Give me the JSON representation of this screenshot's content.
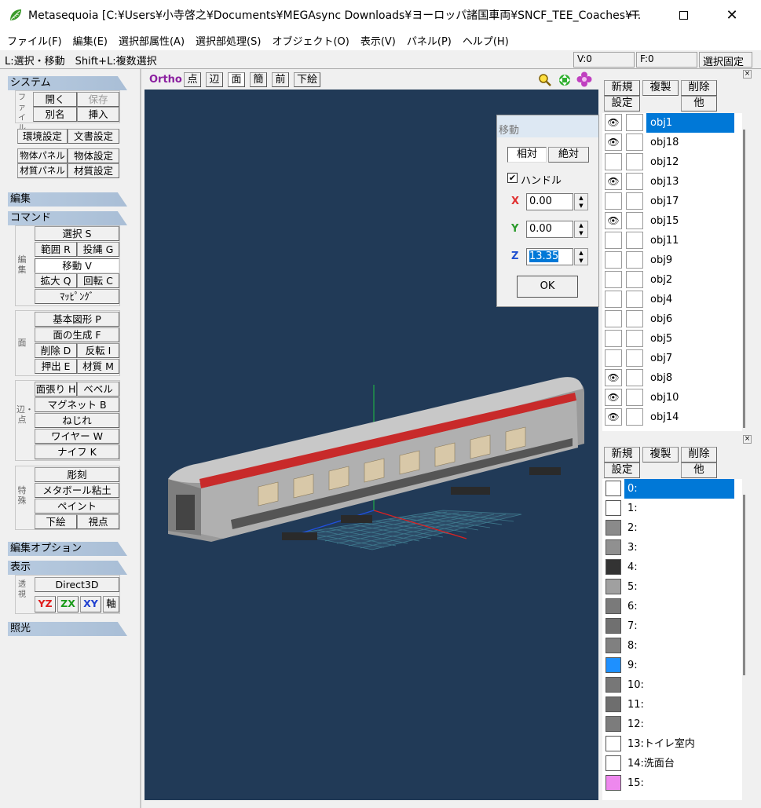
{
  "window": {
    "title": "Metasequoia [C:¥Users¥小寺啓之¥Documents¥MEGAsync Downloads¥ヨーロッパ諸国車両¥SNCF_TEE_Coaches¥T...",
    "minimize_icon": "minimize-icon",
    "maximize_icon": "maximize-icon",
    "close_icon": "close-icon"
  },
  "menu": [
    "ファイル(F)",
    "編集(E)",
    "選択部属性(A)",
    "選択部処理(S)",
    "オブジェクト(O)",
    "表示(V)",
    "パネル(P)",
    "ヘルプ(H)"
  ],
  "status": {
    "hint": "L:選択・移動　Shift+L:複数選択",
    "vertices": "V:0",
    "faces": "F:0",
    "lock": "選択固定"
  },
  "left": {
    "system": {
      "header": "システム",
      "file_label": "ファイル",
      "open": "開く",
      "save": "保存",
      "save_as": "別名",
      "insert": "挿入",
      "env": "環境設定",
      "doc": "文書設定",
      "obj_panel": "物体パネル",
      "obj_settings": "物体設定",
      "mat_panel": "材質パネル",
      "mat_settings": "材質設定"
    },
    "edit_header": "編集",
    "command": {
      "header": "コマンド",
      "edit_label": "編集",
      "face_label": "面",
      "edge_label": "辺・点",
      "special_label": "特殊",
      "select": "選択 S",
      "range": "範囲 R",
      "lasso": "投縄 G",
      "move": "移動 V",
      "scale": "拡大 Q",
      "rotate": "回転 C",
      "mapping": "ﾏｯﾋﾟﾝｸﾞ",
      "primitive": "基本図形 P",
      "face_gen": "面の生成 F",
      "delete": "削除 D",
      "flip": "反転 I",
      "extrude": "押出 E",
      "material": "材質 M",
      "face_stretch": "面張り H",
      "bevel": "ベベル",
      "magnet": "マグネット B",
      "twist": "ねじれ",
      "wire": "ワイヤー W",
      "knife": "ナイフ K",
      "sculpt": "彫刻",
      "metaball": "メタボール粘土",
      "paint": "ペイント",
      "underlay": "下絵",
      "viewpoint": "視点"
    },
    "edit_option_header": "編集オプション",
    "display": {
      "header": "表示",
      "persp_label": "透視",
      "renderer": "Direct3D",
      "yz": "YZ",
      "zx": "ZX",
      "xy": "XY",
      "axis": "軸"
    },
    "light_header": "照光"
  },
  "viewport": {
    "mode": "Ortho",
    "buttons": [
      "点",
      "辺",
      "面",
      "簡",
      "前",
      "下絵"
    ],
    "tools": [
      "zoom-icon",
      "pan-icon",
      "rotate-icon"
    ]
  },
  "move_dialog": {
    "title": "移動",
    "relative": "相対",
    "absolute": "絶対",
    "handle": "ハンドル",
    "handle_checked": true,
    "x_label": "X",
    "x": "0.00",
    "y_label": "Y",
    "y": "0.00",
    "z_label": "Z",
    "z": "13.35",
    "ok": "OK",
    "colors": {
      "x": "#e03030",
      "y": "#2a9a2a",
      "z": "#2050d0"
    }
  },
  "object_panel": {
    "new": "新規",
    "dup": "複製",
    "del": "削除",
    "settings": "設定",
    "other": "他",
    "objects": [
      {
        "name": "obj1",
        "visible": true,
        "selected": true
      },
      {
        "name": "obj18",
        "visible": true
      },
      {
        "name": "obj12",
        "visible": false
      },
      {
        "name": "obj13",
        "visible": true
      },
      {
        "name": "obj17",
        "visible": false
      },
      {
        "name": "obj15",
        "visible": true
      },
      {
        "name": "obj11",
        "visible": false
      },
      {
        "name": "obj9",
        "visible": false
      },
      {
        "name": "obj2",
        "visible": false
      },
      {
        "name": "obj4",
        "visible": false
      },
      {
        "name": "obj6",
        "visible": false
      },
      {
        "name": "obj5",
        "visible": false
      },
      {
        "name": "obj7",
        "visible": false
      },
      {
        "name": "obj8",
        "visible": true
      },
      {
        "name": "obj10",
        "visible": true
      },
      {
        "name": "obj14",
        "visible": true
      }
    ]
  },
  "material_panel": {
    "new": "新規",
    "dup": "複製",
    "del": "削除",
    "settings": "設定",
    "other": "他",
    "materials": [
      {
        "label": "0:",
        "color": "#ffffff",
        "selected": true
      },
      {
        "label": "1:",
        "color": "#ffffff"
      },
      {
        "label": "2:",
        "color": "#8a8a8a"
      },
      {
        "label": "3:",
        "color": "#909090"
      },
      {
        "label": "4:",
        "color": "#333333"
      },
      {
        "label": "5:",
        "color": "#a0a0a0"
      },
      {
        "label": "6:",
        "color": "#7a7a7a"
      },
      {
        "label": "7:",
        "color": "#707070"
      },
      {
        "label": "8:",
        "color": "#808080"
      },
      {
        "label": "9:",
        "color": "#1e90ff"
      },
      {
        "label": "10:",
        "color": "#777777"
      },
      {
        "label": "11:",
        "color": "#6e6e6e"
      },
      {
        "label": "12:",
        "color": "#7c7c7c"
      },
      {
        "label": "13:トイレ室内",
        "color": "#ffffff"
      },
      {
        "label": "14:洗面台",
        "color": "#ffffff"
      },
      {
        "label": "15:",
        "color": "#ee88ee"
      }
    ]
  }
}
